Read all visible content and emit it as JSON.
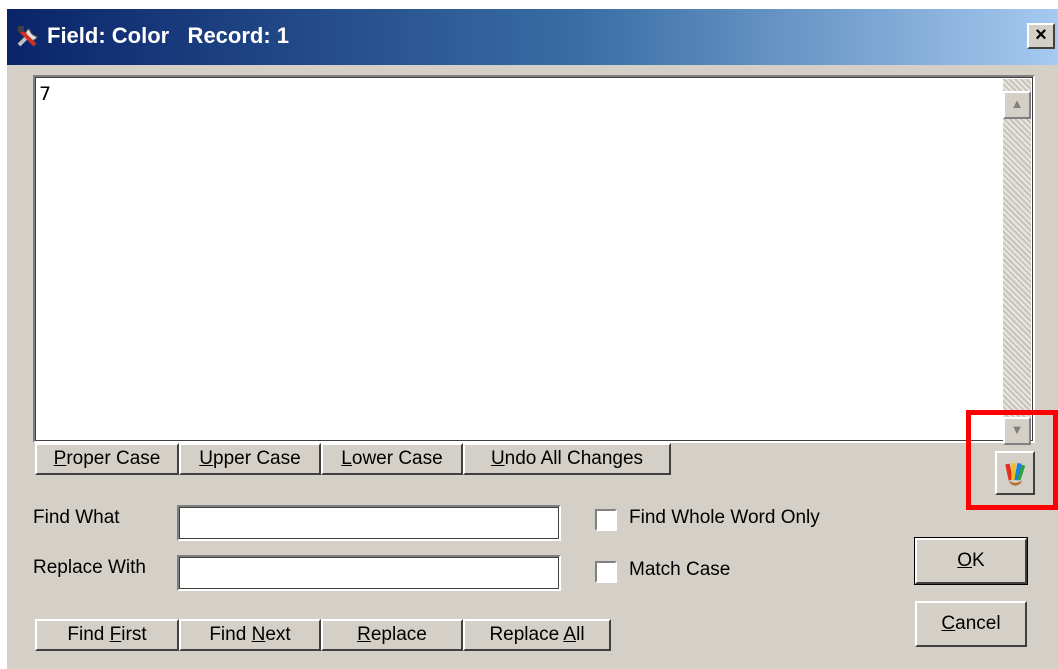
{
  "window": {
    "title": "Field: Color   Record: 1",
    "close_symbol": "×"
  },
  "memo": {
    "value": "7",
    "scroll_up_symbol": "▲",
    "scroll_down_symbol": "▼"
  },
  "case_buttons": {
    "proper_pre": "",
    "proper_key": "P",
    "proper_post": "roper Case",
    "upper_pre": "",
    "upper_key": "U",
    "upper_post": "pper Case",
    "lower_pre": "",
    "lower_key": "L",
    "lower_post": "ower Case",
    "undo_pre": "",
    "undo_key": "U",
    "undo_post": "ndo All Changes"
  },
  "find": {
    "find_label": "Find What",
    "find_value": "",
    "replace_label": "Replace With",
    "replace_value": "",
    "whole_word_label": "Find Whole Word Only",
    "match_case_label": "Match Case"
  },
  "find_buttons": {
    "first_pre": "Find ",
    "first_key": "F",
    "first_post": "irst",
    "next_pre": "Find ",
    "next_key": "N",
    "next_post": "ext",
    "replace_pre": "",
    "replace_key": "R",
    "replace_post": "eplace",
    "all_pre": "Replace ",
    "all_key": "A",
    "all_post": "ll"
  },
  "actions": {
    "ok_key": "O",
    "ok_post": "K",
    "cancel_key": "C",
    "cancel_post": "ancel"
  },
  "colors": {
    "highlight": "#ff0000",
    "title_start": "#0a246a",
    "title_end": "#a6caf0"
  },
  "icons": {
    "title": "tools-icon",
    "color_picker": "crayons-icon"
  }
}
